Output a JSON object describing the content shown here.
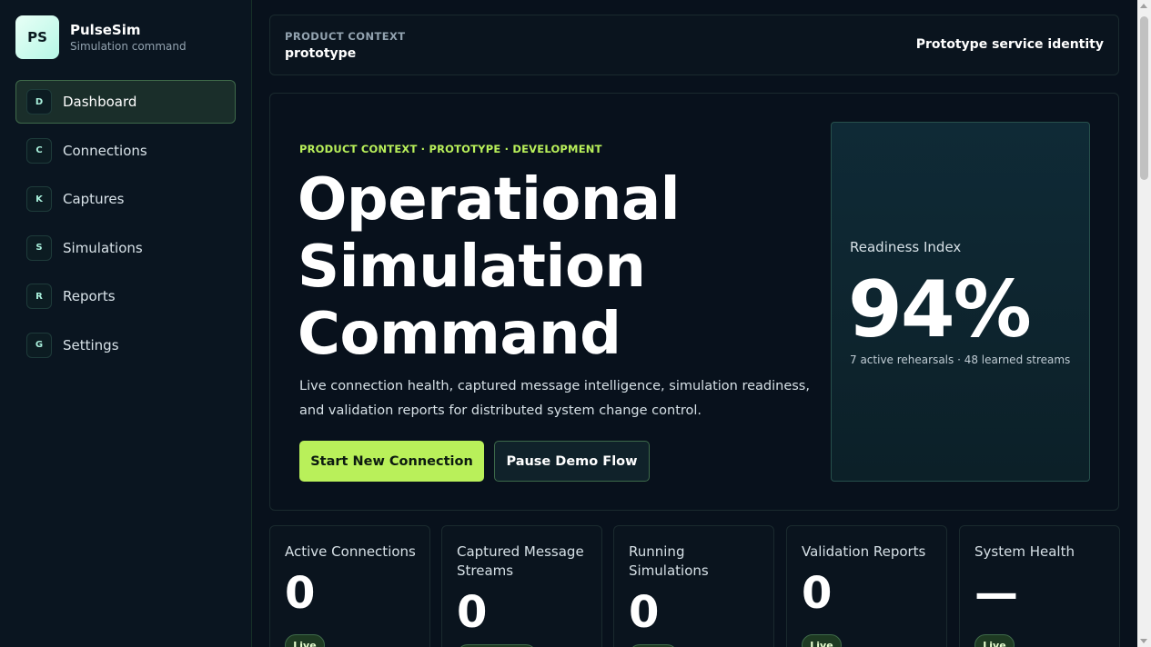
{
  "brand": {
    "logo": "PS",
    "name": "PulseSim",
    "subtitle": "Simulation command"
  },
  "nav": [
    {
      "key": "D",
      "label": "Dashboard",
      "active": true
    },
    {
      "key": "C",
      "label": "Connections"
    },
    {
      "key": "K",
      "label": "Captures"
    },
    {
      "key": "S",
      "label": "Simulations"
    },
    {
      "key": "R",
      "label": "Reports"
    },
    {
      "key": "G",
      "label": "Settings"
    }
  ],
  "context": {
    "label": "PRODUCT CONTEXT",
    "value": "prototype",
    "identity": "Prototype service identity"
  },
  "hero": {
    "eyebrow": "PRODUCT CONTEXT · PROTOTYPE · DEVELOPMENT",
    "title_lines": [
      "Operational",
      "Simulation",
      "Command"
    ],
    "description": "Live connection health, captured message intelligence, simulation readiness, and validation reports for distributed system change control.",
    "primary_button": "Start New Connection",
    "secondary_button": "Pause Demo Flow"
  },
  "readiness": {
    "label": "Readiness Index",
    "value": "94%",
    "subtitle": "7 active rehearsals · 48 learned streams"
  },
  "stats": [
    {
      "label": "Active Connections",
      "value": "0",
      "badge": "Live"
    },
    {
      "label": "Captured Message Streams",
      "value": "0",
      "badge": ""
    },
    {
      "label": "Running Simulations",
      "value": "0",
      "badge": ""
    },
    {
      "label": "Validation Reports",
      "value": "0",
      "badge": "Live"
    },
    {
      "label": "System Health",
      "value": "—",
      "badge": "Live"
    }
  ],
  "colors": {
    "accent": "#b9f05a",
    "background": "#08111c",
    "sidebar": "#0a1520"
  }
}
